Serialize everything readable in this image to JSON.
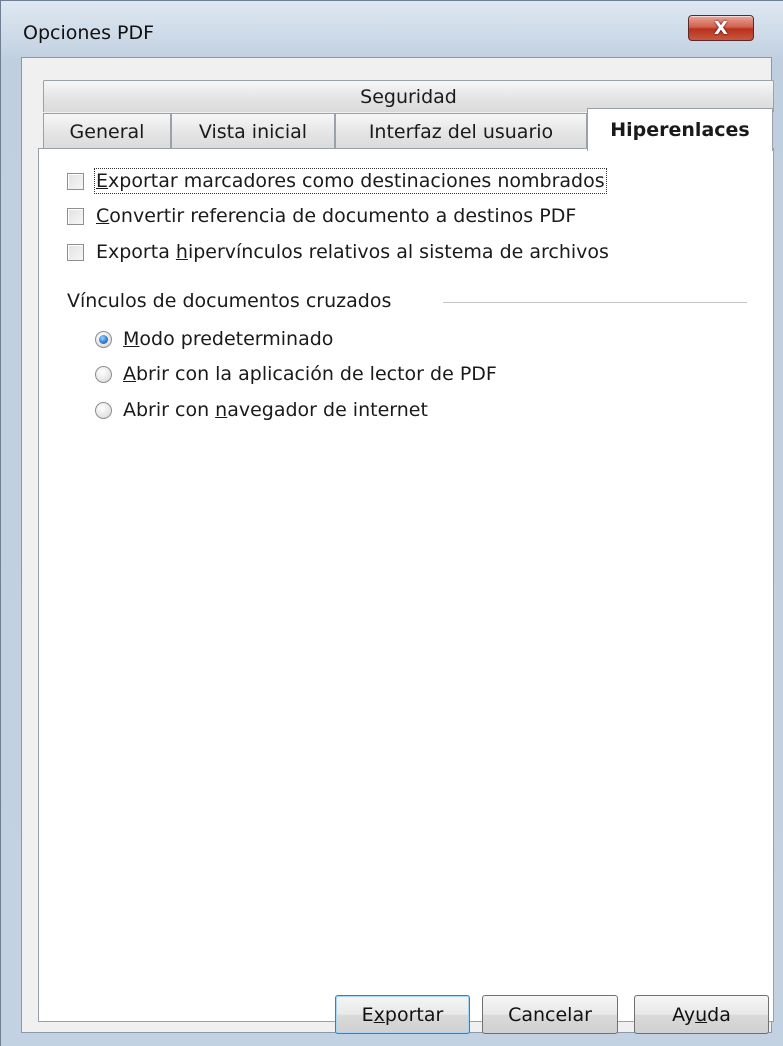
{
  "window": {
    "title": "Opciones PDF",
    "close_glyph": "X"
  },
  "tabs": {
    "row1": [
      "Seguridad"
    ],
    "row2": [
      "General",
      "Vista inicial",
      "Interfaz del usuario",
      "Hiperenlaces"
    ],
    "active": "Hiperenlaces"
  },
  "checkboxes": [
    {
      "pre": "",
      "accel": "E",
      "post": "xportar marcadores como destinaciones nombrados",
      "checked": false,
      "focused": true
    },
    {
      "pre": "",
      "accel": "C",
      "post": "onvertir referencia de documento a destinos PDF",
      "checked": false
    },
    {
      "pre": "Exporta ",
      "accel": "h",
      "post": "ipervínculos relativos al sistema de archivos",
      "checked": false
    }
  ],
  "group": {
    "label": "Vínculos de documentos cruzados"
  },
  "radios": [
    {
      "pre": "",
      "accel": "M",
      "post": "odo predeterminado",
      "selected": true
    },
    {
      "pre": "",
      "accel": "A",
      "post": "brir con la aplicación de lector de PDF",
      "selected": false
    },
    {
      "pre": "Abrir con ",
      "accel": "n",
      "post": "avegador de internet",
      "selected": false
    }
  ],
  "buttons": {
    "export": {
      "pre": "E",
      "accel": "x",
      "post": "portar"
    },
    "cancel": {
      "label": "Cancelar"
    },
    "help": {
      "pre": "Ay",
      "accel": "u",
      "post": "da"
    }
  },
  "icons": {
    "close": "close-icon",
    "checkbox": "checkbox-icon",
    "radio": "radio-icon"
  }
}
